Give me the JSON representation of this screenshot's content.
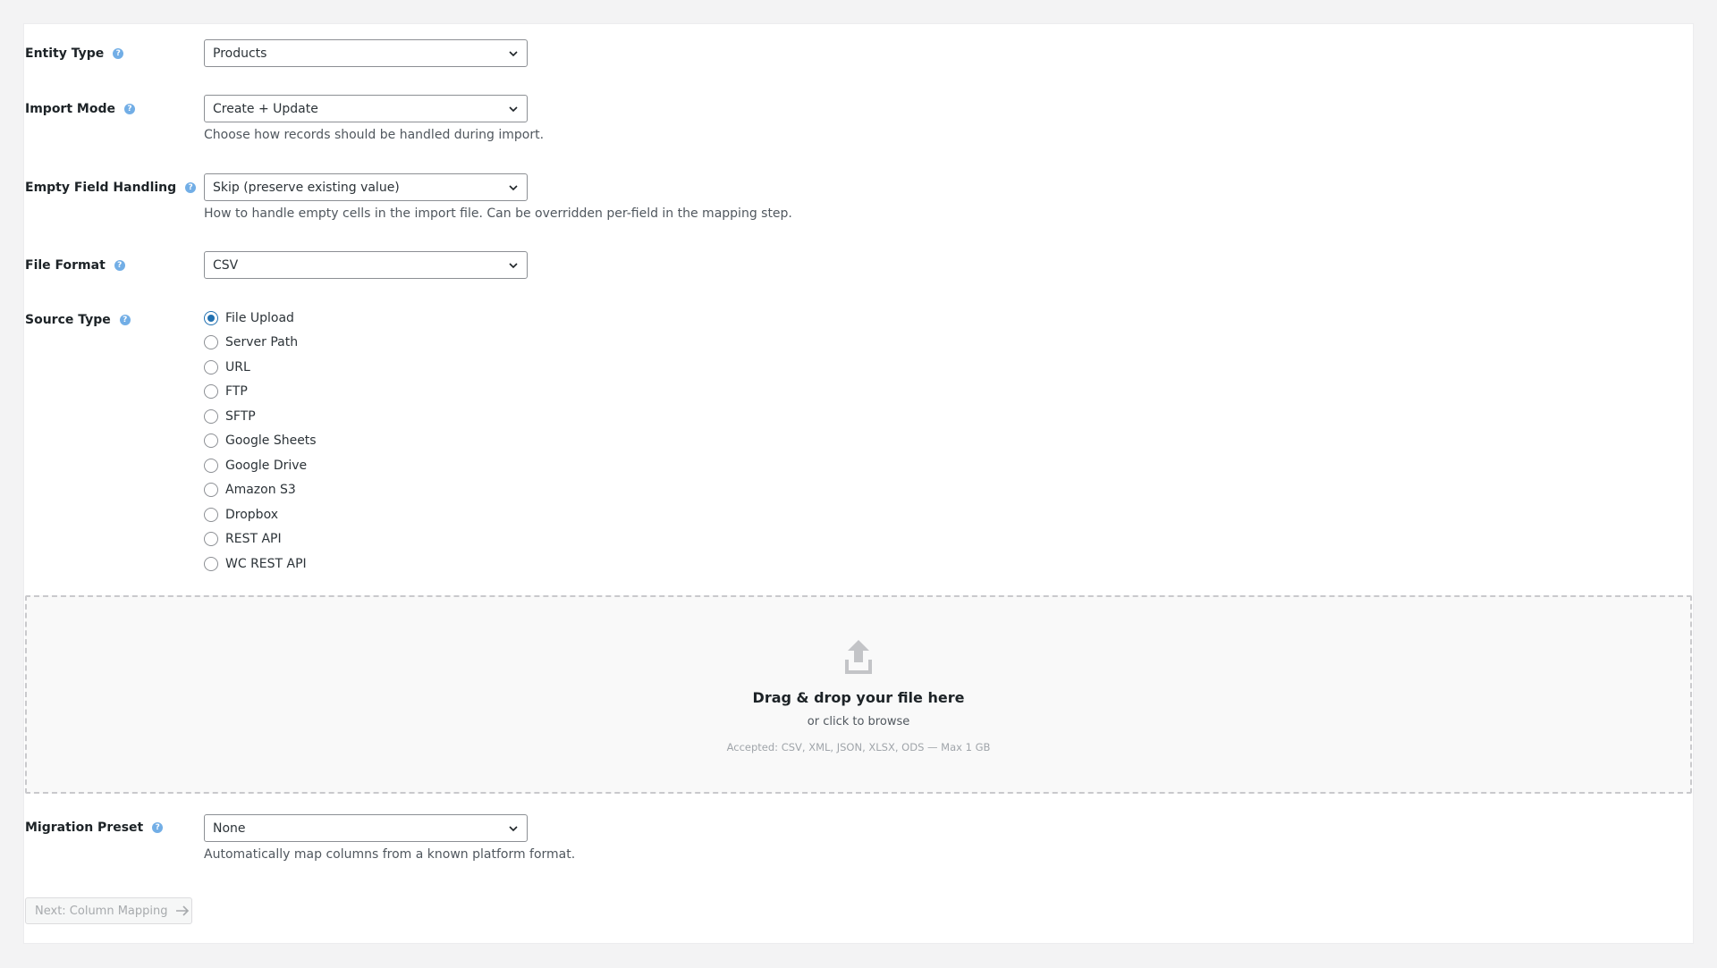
{
  "fields": {
    "entity_type": {
      "label": "Entity Type",
      "value": "Products"
    },
    "import_mode": {
      "label": "Import Mode",
      "value": "Create + Update",
      "description": "Choose how records should be handled during import."
    },
    "empty_field_handling": {
      "label": "Empty Field Handling",
      "value": "Skip (preserve existing value)",
      "description": "How to handle empty cells in the import file. Can be overridden per-field in the mapping step."
    },
    "file_format": {
      "label": "File Format",
      "value": "CSV"
    },
    "source_type": {
      "label": "Source Type",
      "selected": "File Upload",
      "options": [
        "File Upload",
        "Server Path",
        "URL",
        "FTP",
        "SFTP",
        "Google Sheets",
        "Google Drive",
        "Amazon S3",
        "Dropbox",
        "REST API",
        "WC REST API"
      ]
    },
    "migration_preset": {
      "label": "Migration Preset",
      "value": "None",
      "description": "Automatically map columns from a known platform format."
    }
  },
  "dropzone": {
    "title": "Drag & drop your file here",
    "subtitle": "or click to browse",
    "accepted": "Accepted: CSV, XML, JSON, XLSX, ODS — Max 1 GB",
    "icon": "upload-icon"
  },
  "help_glyph": "?",
  "next_button": {
    "label": "Next: Column Mapping",
    "icon": "arrow-right-icon"
  },
  "colors": {
    "accent": "#2271b1",
    "help": "#72aee6",
    "text": "#1d2327",
    "muted": "#50575e"
  }
}
